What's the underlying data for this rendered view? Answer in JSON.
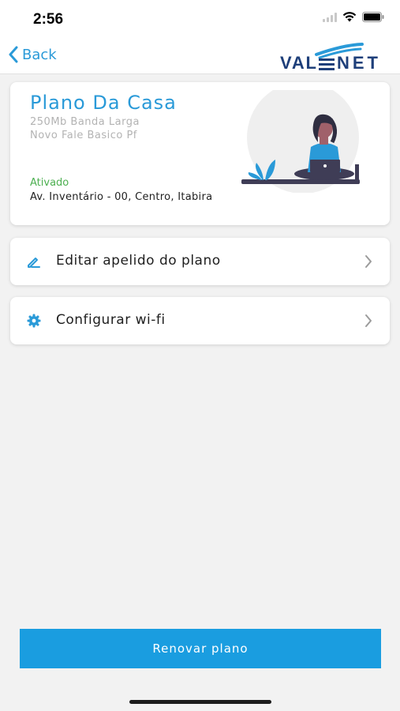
{
  "status_bar": {
    "time": "2:56"
  },
  "nav": {
    "back_label": "Back",
    "logo_text": "VAL",
    "logo_text2": "NET"
  },
  "plan": {
    "title": "Plano Da Casa",
    "speed": "250Mb Banda Larga",
    "name": "Novo Fale Basico Pf",
    "status": "Ativado",
    "address": "Av. Inventário - 00, Centro, Itabira"
  },
  "menu": [
    {
      "label": "Editar apelido do plano",
      "icon": "pencil-icon"
    },
    {
      "label": "Configurar wi-fi",
      "icon": "gear-icon"
    }
  ],
  "renew_button": {
    "label": "Renovar plano"
  },
  "colors": {
    "accent": "#2a9ad8",
    "button": "#1a9de0",
    "status_active": "#4caf50"
  }
}
